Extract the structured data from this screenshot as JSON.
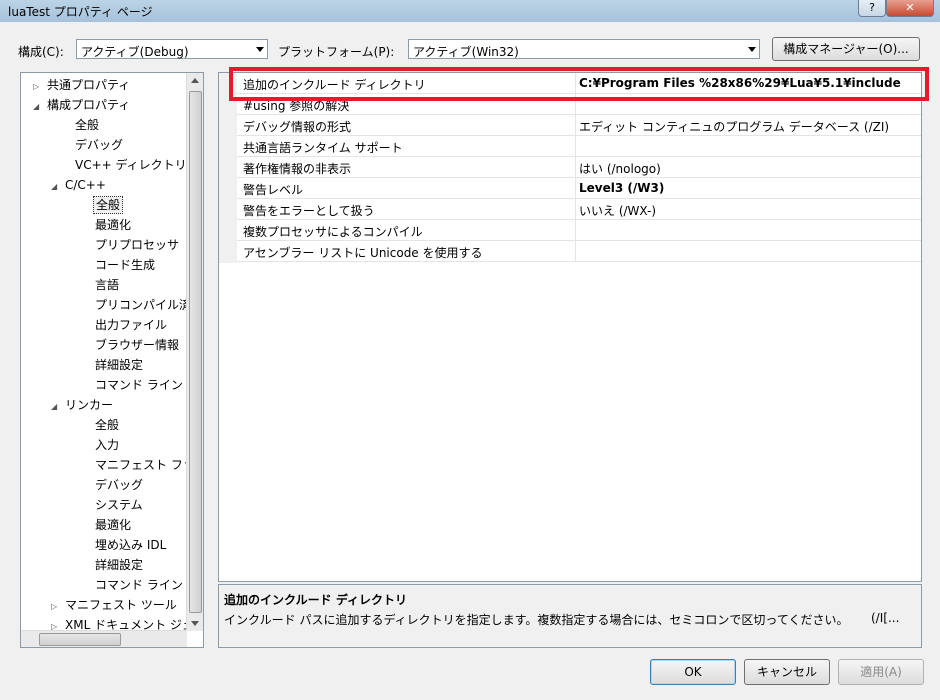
{
  "window": {
    "title": "luaTest プロパティ ページ",
    "help_label": "?",
    "close_label": "✕"
  },
  "toolbar": {
    "config_label": "構成(C):",
    "config_value": "アクティブ(Debug)",
    "platform_label": "プラットフォーム(P):",
    "platform_value": "アクティブ(Win32)",
    "config_manager_label": "構成マネージャー(O)..."
  },
  "tree": {
    "items": [
      {
        "label": "共通プロパティ",
        "expander": "▷"
      },
      {
        "label": "構成プロパティ",
        "expander": "◢"
      },
      {
        "label": "全般",
        "expander": ""
      },
      {
        "label": "デバッグ",
        "expander": ""
      },
      {
        "label": "VC++ ディレクトリ",
        "expander": ""
      },
      {
        "label": "C/C++",
        "expander": "◢"
      },
      {
        "label": "全般",
        "expander": ""
      },
      {
        "label": "最適化",
        "expander": ""
      },
      {
        "label": "プリプロセッサ",
        "expander": ""
      },
      {
        "label": "コード生成",
        "expander": ""
      },
      {
        "label": "言語",
        "expander": ""
      },
      {
        "label": "プリコンパイル済み",
        "expander": ""
      },
      {
        "label": "出力ファイル",
        "expander": ""
      },
      {
        "label": "ブラウザー情報",
        "expander": ""
      },
      {
        "label": "詳細設定",
        "expander": ""
      },
      {
        "label": "コマンド ライン",
        "expander": ""
      },
      {
        "label": "リンカー",
        "expander": "◢"
      },
      {
        "label": "全般",
        "expander": ""
      },
      {
        "label": "入力",
        "expander": ""
      },
      {
        "label": "マニフェスト ファイ",
        "expander": ""
      },
      {
        "label": "デバッグ",
        "expander": ""
      },
      {
        "label": "システム",
        "expander": ""
      },
      {
        "label": "最適化",
        "expander": ""
      },
      {
        "label": "埋め込み IDL",
        "expander": ""
      },
      {
        "label": "詳細設定",
        "expander": ""
      },
      {
        "label": "コマンド ライン",
        "expander": ""
      },
      {
        "label": "マニフェスト ツール",
        "expander": "▷"
      },
      {
        "label": "XML ドキュメント ジェ",
        "expander": "▷"
      }
    ]
  },
  "properties": [
    {
      "name": "追加のインクルード ディレクトリ",
      "value": "C:¥Program Files %28x86%29¥Lua¥5.1¥include",
      "bold": true
    },
    {
      "name": "#using 参照の解決",
      "value": "",
      "bold": false
    },
    {
      "name": "デバッグ情報の形式",
      "value": "エディット コンティニュのプログラム データベース (/ZI)",
      "bold": false
    },
    {
      "name": "共通言語ランタイム サポート",
      "value": "",
      "bold": false
    },
    {
      "name": "著作権情報の非表示",
      "value": "はい (/nologo)",
      "bold": false
    },
    {
      "name": "警告レベル",
      "value": "Level3 (/W3)",
      "bold": true
    },
    {
      "name": "警告をエラーとして扱う",
      "value": "いいえ (/WX-)",
      "bold": false
    },
    {
      "name": "複数プロセッサによるコンパイル",
      "value": "",
      "bold": false
    },
    {
      "name": "アセンブラー リストに Unicode を使用する",
      "value": "",
      "bold": false
    }
  ],
  "description": {
    "title": "追加のインクルード ディレクトリ",
    "text": "インクルード パスに追加するディレクトリを指定します。複数指定する場合には、セミコロンで区切ってください。",
    "tail": "(/I[..."
  },
  "buttons": {
    "ok": "OK",
    "cancel": "キャンセル",
    "apply": "適用(A)"
  },
  "colors": {
    "highlight_border": "#e51a2a"
  }
}
